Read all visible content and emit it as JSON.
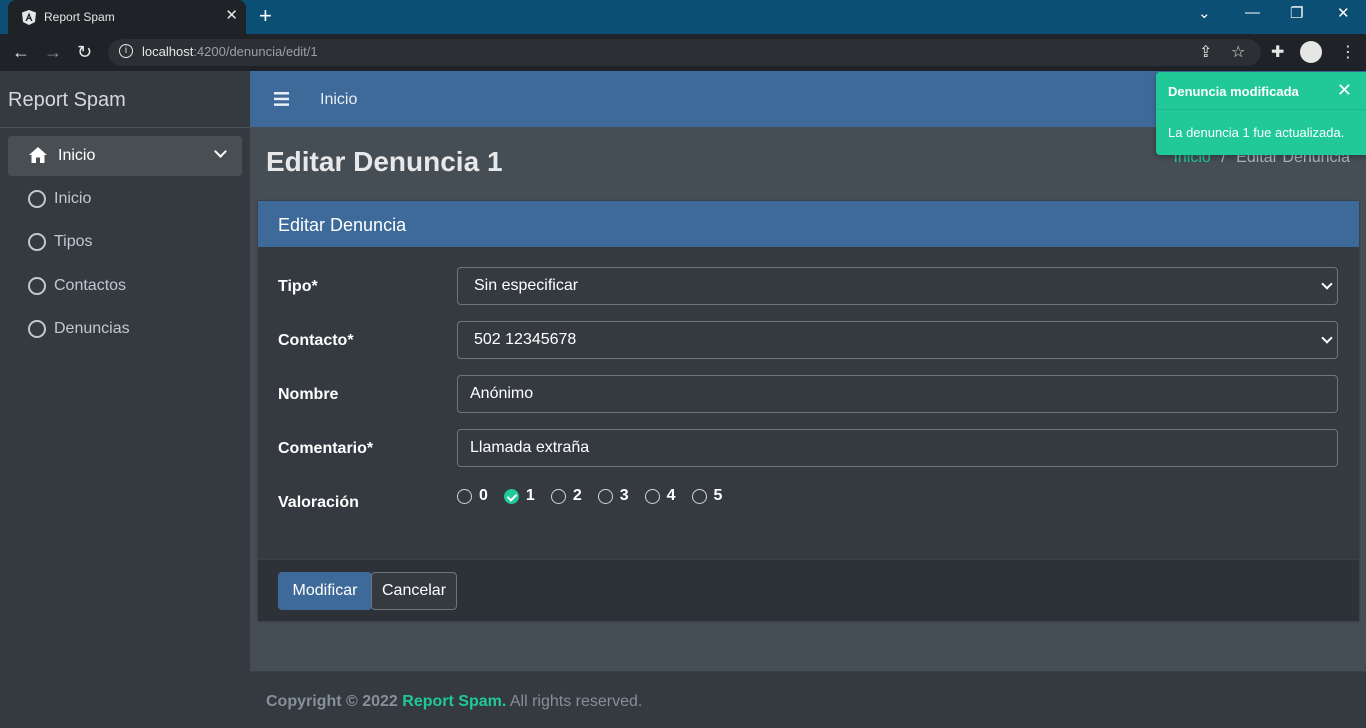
{
  "browser": {
    "tab_title": "Report Spam",
    "new_tab": "+",
    "url_host": "localhost",
    "url_path": ":4200/denuncia/edit/1"
  },
  "sidebar": {
    "brand": "Report Spam",
    "menu_header": "Inicio",
    "items": [
      {
        "label": "Inicio"
      },
      {
        "label": "Tipos"
      },
      {
        "label": "Contactos"
      },
      {
        "label": "Denuncias"
      }
    ]
  },
  "header": {
    "link": "Inicio"
  },
  "page": {
    "title": "Editar Denuncia 1",
    "breadcrumb_home": "Inicio",
    "breadcrumb_sep": "/",
    "breadcrumb_current": "Editar Denuncia"
  },
  "card": {
    "title": "Editar Denuncia",
    "fields": {
      "tipo_label": "Tipo*",
      "tipo_value": "Sin especificar",
      "contacto_label": "Contacto*",
      "contacto_value": "502 12345678",
      "nombre_label": "Nombre",
      "nombre_value": "Anónimo",
      "comentario_label": "Comentario*",
      "comentario_value": "Llamada extraña",
      "valoracion_label": "Valoración",
      "valoracion_options": [
        "0",
        "1",
        "2",
        "3",
        "4",
        "5"
      ],
      "valoracion_selected": "1"
    },
    "modify_button": "Modificar",
    "cancel_button": "Cancelar"
  },
  "footer": {
    "copyright": "Copyright © 2022",
    "brand": "Report Spam.",
    "rights": "All rights reserved."
  },
  "toast": {
    "title": "Denuncia modificada",
    "message": "La denuncia 1 fue actualizada.",
    "color": "#20c997"
  },
  "colors": {
    "primary": "#3e6a9a",
    "accent": "#20c997",
    "sidebar_bg": "#343a40",
    "content_bg": "#454d55"
  }
}
